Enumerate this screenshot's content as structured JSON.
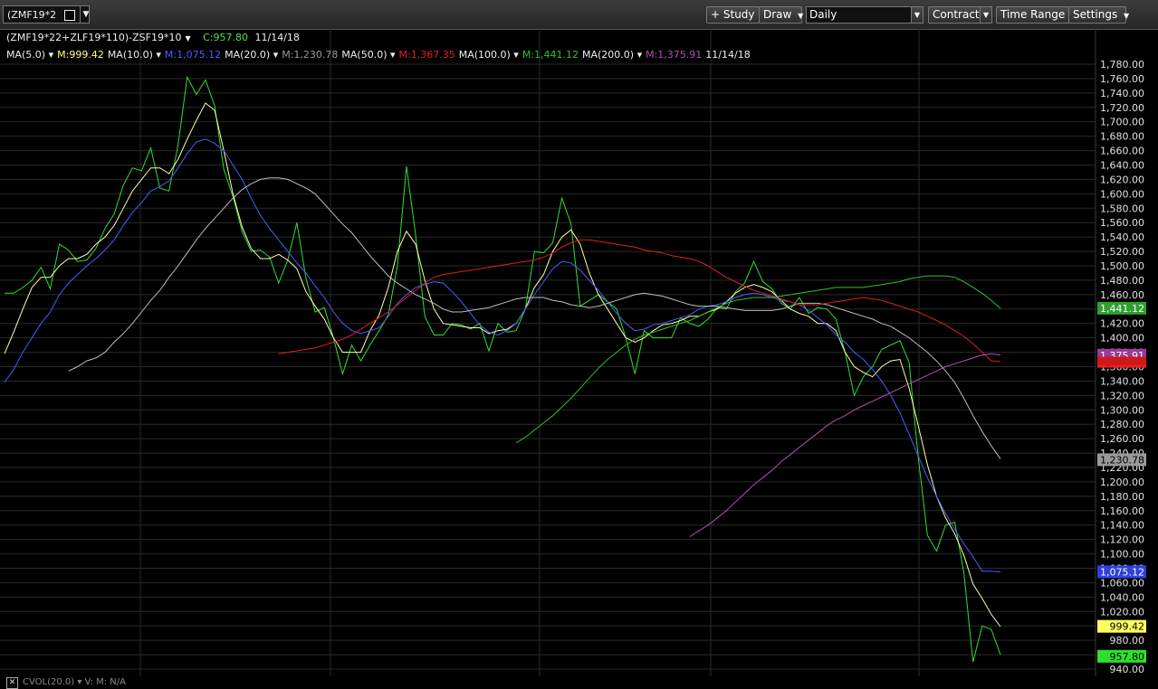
{
  "toolbar": {
    "symbol": "(ZMF19*2",
    "study_label": "+ Study",
    "draw_label": "Draw",
    "period_label": "Daily",
    "contract_label": "Contract",
    "time_range_label": "Time Range",
    "settings_label": "Settings"
  },
  "legend": {
    "expression": "(ZMF19*22+ZLF19*110)-ZSF19*10",
    "close": "C:957.80",
    "date": "11/14/18",
    "mas": [
      {
        "label": "MA(5.0)",
        "value": "M:999.42",
        "color": "#ffff88"
      },
      {
        "label": "MA(10.0)",
        "value": "M:1,075.12",
        "color": "#4a5cff"
      },
      {
        "label": "MA(20.0)",
        "value": "M:1,230.78",
        "color": "#9a9a9a"
      },
      {
        "label": "MA(50.0)",
        "value": "M:1,367.35",
        "color": "#e02020"
      },
      {
        "label": "MA(100.0)",
        "value": "M:1,441.12",
        "color": "#2fc02f"
      },
      {
        "label": "MA(200.0)",
        "value": "M:1,375.91",
        "color": "#b050b0"
      }
    ]
  },
  "bottom": {
    "cvol": "CVOL(20.0) ▾  V: M: N/A"
  },
  "chart_data": {
    "type": "line",
    "ylim": [
      940,
      1780
    ],
    "y_ticks": [
      "1,780.00",
      "1,760.00",
      "1,740.00",
      "1,720.00",
      "1,700.00",
      "1,680.00",
      "1,660.00",
      "1,640.00",
      "1,620.00",
      "1,600.00",
      "1,580.00",
      "1,560.00",
      "1,540.00",
      "1,520.00",
      "1,500.00",
      "1,480.00",
      "1,460.00",
      "1,440.00",
      "1,420.00",
      "1,400.00",
      "1,380.00",
      "1,360.00",
      "1,340.00",
      "1,320.00",
      "1,300.00",
      "1,280.00",
      "1,260.00",
      "1,240.00",
      "1,220.00",
      "1,200.00",
      "1,180.00",
      "1,160.00",
      "1,140.00",
      "1,120.00",
      "1,100.00",
      "1,080.00",
      "1,060.00",
      "1,040.00",
      "1,020.00",
      "1,000.00",
      "980.00",
      "960.00",
      "940.00"
    ],
    "series": [
      {
        "name": "(ZMF19*22+ZLF19*110)-ZSF19*10",
        "color": "#2ee02e",
        "badge": "957.80",
        "values": [
          1462,
          1462,
          1470,
          1480,
          1498,
          1468,
          1530,
          1522,
          1506,
          1508,
          1524,
          1552,
          1572,
          1612,
          1636,
          1632,
          1664,
          1608,
          1604,
          1668,
          1762,
          1738,
          1758,
          1722,
          1634,
          1596,
          1548,
          1520,
          1522,
          1512,
          1476,
          1508,
          1560,
          1482,
          1436,
          1442,
          1400,
          1350,
          1390,
          1368,
          1390,
          1410,
          1432,
          1500,
          1638,
          1542,
          1430,
          1404,
          1404,
          1420,
          1418,
          1412,
          1420,
          1382,
          1420,
          1408,
          1410,
          1440,
          1520,
          1518,
          1532,
          1594,
          1558,
          1444,
          1452,
          1460,
          1450,
          1440,
          1400,
          1350,
          1410,
          1400,
          1400,
          1400,
          1428,
          1420,
          1416,
          1426,
          1442,
          1440,
          1464,
          1476,
          1506,
          1478,
          1468,
          1448,
          1440,
          1456,
          1434,
          1442,
          1440,
          1426,
          1380,
          1320,
          1346,
          1360,
          1384,
          1390,
          1396,
          1366,
          1234,
          1126,
          1104,
          1140,
          1144,
          1074,
          950,
          1000,
          995,
          960
        ]
      },
      {
        "name": "MA(5.0)",
        "color": "#ffffa8",
        "badge": "999.42",
        "values": [
          1378,
          1408,
          1440,
          1470,
          1484,
          1484,
          1500,
          1510,
          1510,
          1516,
          1530,
          1540,
          1556,
          1580,
          1604,
          1620,
          1636,
          1636,
          1628,
          1648,
          1676,
          1702,
          1726,
          1716,
          1660,
          1600,
          1554,
          1524,
          1510,
          1510,
          1516,
          1508,
          1496,
          1464,
          1444,
          1426,
          1400,
          1380,
          1380,
          1380,
          1410,
          1432,
          1470,
          1520,
          1548,
          1530,
          1480,
          1440,
          1420,
          1418,
          1416,
          1414,
          1414,
          1406,
          1410,
          1412,
          1420,
          1440,
          1470,
          1488,
          1520,
          1540,
          1550,
          1530,
          1490,
          1460,
          1440,
          1420,
          1400,
          1394,
          1400,
          1410,
          1418,
          1420,
          1424,
          1430,
          1430,
          1436,
          1440,
          1450,
          1462,
          1470,
          1474,
          1470,
          1464,
          1452,
          1440,
          1434,
          1430,
          1420,
          1420,
          1410,
          1380,
          1360,
          1352,
          1346,
          1360,
          1368,
          1370,
          1330,
          1278,
          1224,
          1180,
          1150,
          1128,
          1098,
          1058,
          1038,
          1016,
          999
        ]
      },
      {
        "name": "MA(10.0)",
        "color": "#4a5cff",
        "badge": "1,075.12",
        "values": [
          1338,
          1356,
          1380,
          1400,
          1420,
          1436,
          1460,
          1476,
          1488,
          1500,
          1510,
          1522,
          1536,
          1556,
          1574,
          1588,
          1604,
          1610,
          1618,
          1636,
          1656,
          1672,
          1676,
          1670,
          1660,
          1640,
          1620,
          1594,
          1570,
          1552,
          1536,
          1520,
          1504,
          1490,
          1472,
          1456,
          1436,
          1420,
          1410,
          1406,
          1410,
          1414,
          1430,
          1448,
          1460,
          1470,
          1474,
          1478,
          1476,
          1464,
          1450,
          1434,
          1418,
          1408,
          1404,
          1410,
          1420,
          1440,
          1460,
          1478,
          1496,
          1506,
          1504,
          1494,
          1480,
          1466,
          1450,
          1434,
          1420,
          1410,
          1412,
          1418,
          1420,
          1424,
          1428,
          1432,
          1440,
          1444,
          1446,
          1450,
          1456,
          1460,
          1462,
          1460,
          1456,
          1452,
          1450,
          1446,
          1438,
          1428,
          1418,
          1404,
          1394,
          1380,
          1370,
          1356,
          1340,
          1320,
          1296,
          1266,
          1236,
          1206,
          1180,
          1156,
          1134,
          1114,
          1096,
          1076,
          1076,
          1075
        ]
      },
      {
        "name": "MA(20.0)",
        "color": "#bdbdbd",
        "badge": "1,230.78",
        "values": [
          1354,
          1360,
          1368,
          1372,
          1380,
          1394,
          1406,
          1420,
          1436,
          1452,
          1466,
          1484,
          1500,
          1518,
          1536,
          1552,
          1566,
          1580,
          1594,
          1606,
          1614,
          1620,
          1622,
          1622,
          1620,
          1614,
          1608,
          1600,
          1586,
          1572,
          1558,
          1546,
          1530,
          1514,
          1500,
          1486,
          1476,
          1468,
          1460,
          1454,
          1448,
          1440,
          1436,
          1436,
          1438,
          1440,
          1442,
          1446,
          1450,
          1454,
          1456,
          1456,
          1456,
          1452,
          1450,
          1446,
          1444,
          1442,
          1444,
          1448,
          1452,
          1456,
          1460,
          1462,
          1460,
          1458,
          1454,
          1450,
          1446,
          1444,
          1444,
          1444,
          1442,
          1440,
          1438,
          1438,
          1438,
          1438,
          1440,
          1444,
          1448,
          1448,
          1448,
          1446,
          1442,
          1438,
          1434,
          1430,
          1426,
          1420,
          1416,
          1408,
          1400,
          1390,
          1380,
          1368,
          1354,
          1338,
          1316,
          1292,
          1270,
          1250,
          1232
        ]
      },
      {
        "name": "MA(50.0)",
        "color": "#e02020",
        "badge": "1,367.35",
        "values": [
          1378,
          1380,
          1382,
          1384,
          1386,
          1390,
          1394,
          1398,
          1404,
          1412,
          1420,
          1428,
          1436,
          1446,
          1456,
          1466,
          1476,
          1484,
          1488,
          1490,
          1492,
          1494,
          1496,
          1498,
          1500,
          1502,
          1504,
          1506,
          1508,
          1512,
          1518,
          1526,
          1532,
          1536,
          1536,
          1534,
          1532,
          1530,
          1528,
          1526,
          1522,
          1520,
          1518,
          1514,
          1512,
          1510,
          1506,
          1500,
          1492,
          1484,
          1478,
          1472,
          1466,
          1462,
          1458,
          1454,
          1450,
          1446,
          1446,
          1446,
          1448,
          1450,
          1452,
          1454,
          1456,
          1454,
          1452,
          1448,
          1444,
          1440,
          1436,
          1430,
          1424,
          1418,
          1410,
          1402,
          1392,
          1380,
          1368,
          1367
        ]
      },
      {
        "name": "MA(100.0)",
        "color": "#2fc02f",
        "badge": "1,441.12",
        "values": [
          1254,
          1262,
          1272,
          1282,
          1292,
          1304,
          1316,
          1330,
          1344,
          1358,
          1370,
          1380,
          1390,
          1398,
          1404,
          1408,
          1412,
          1416,
          1420,
          1424,
          1430,
          1436,
          1442,
          1448,
          1452,
          1454,
          1456,
          1456,
          1456,
          1458,
          1460,
          1462,
          1464,
          1466,
          1468,
          1470,
          1470,
          1470,
          1470,
          1472,
          1474,
          1476,
          1478,
          1482,
          1484,
          1486,
          1486,
          1486,
          1484,
          1478,
          1470,
          1462,
          1452,
          1441
        ]
      },
      {
        "name": "MA(200.0)",
        "color": "#b050b0",
        "badge": "1,375.91",
        "values": [
          1124,
          1132,
          1140,
          1150,
          1160,
          1172,
          1184,
          1196,
          1206,
          1216,
          1228,
          1238,
          1248,
          1258,
          1268,
          1278,
          1286,
          1292,
          1300,
          1306,
          1312,
          1318,
          1324,
          1330,
          1336,
          1342,
          1348,
          1354,
          1360,
          1364,
          1368,
          1372,
          1376,
          1378,
          1376
        ]
      }
    ]
  }
}
